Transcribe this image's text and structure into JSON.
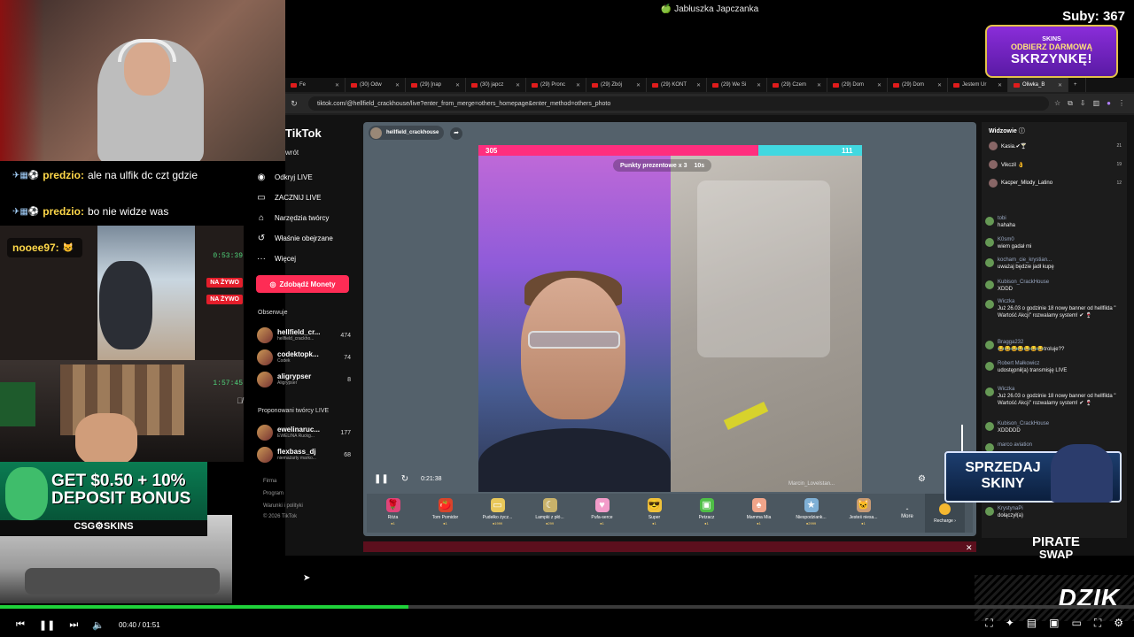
{
  "window": {
    "title": "🍏 Jabłuszka Japczanka"
  },
  "overlay": {
    "subs": "Suby: 367",
    "promo_brand": "SKINS",
    "promo_l1": "ODBIERZ DARMOWĄ",
    "promo_l2": "SKRZYNKĘ!",
    "chat": [
      {
        "name": "predzio:",
        "text": "ale na ulfik dc czt gdzie"
      },
      {
        "name": "predzio:",
        "text": "bo nie widze was"
      },
      {
        "name": "nooee97:",
        "text": ""
      }
    ],
    "cam_times": [
      "0:53:39",
      "1:57:45"
    ],
    "live_label": "NA ŻYWO",
    "bonus_ad_text": "GET $0.50 + 10% DEPOSIT BONUS",
    "bonus_ad_l1": "GET $0.50 + 10%",
    "bonus_ad_l2": "DEPOSIT BONUS",
    "bonus_ad_brand": "CSG⚙SKINS",
    "sell_ad_l1": "SPRZEDAJ",
    "sell_ad_l2": "SKINY",
    "pirate_l1": "PIRATE",
    "pirate_l2": "SWAP",
    "dzik_logo": "DZIK"
  },
  "browser": {
    "tabs": [
      {
        "label": "Fe"
      },
      {
        "label": "(30) Odw"
      },
      {
        "label": "(29) [nap"
      },
      {
        "label": "(30) japcz"
      },
      {
        "label": "(29) Pronc"
      },
      {
        "label": "(29) Zbój"
      },
      {
        "label": "(29) KONT"
      },
      {
        "label": "(29) We Si"
      },
      {
        "label": "(29) Czem"
      },
      {
        "label": "(29) Dom"
      },
      {
        "label": "(29) Dom"
      },
      {
        "label": "Jestem Ur"
      },
      {
        "label": "Oliwka_B"
      }
    ],
    "url": "tiktok.com/@hellfield_crackhouse/live?enter_from_merge=others_homepage&enter_method=others_photo"
  },
  "tiktok": {
    "logo": "TikTok",
    "back": "wrót",
    "menu": [
      {
        "icon": "◉",
        "label": "Odkryj LIVE"
      },
      {
        "icon": "▭",
        "label": "ZACZNIJ LIVE"
      },
      {
        "icon": "⌂",
        "label": "Narzędzia twórcy"
      },
      {
        "icon": "↺",
        "label": "Właśnie obejrzane"
      },
      {
        "icon": "···",
        "label": "Więcej"
      }
    ],
    "coins_button": "Zdobądź Monety",
    "following_header": "Obserwuje",
    "following": [
      {
        "name": "hellfield_cr...",
        "sub": "hellfield_crackho...",
        "count": "474"
      },
      {
        "name": "codektopk...",
        "sub": "Codek",
        "count": "74"
      },
      {
        "name": "aligrypser",
        "sub": "Aligrypser",
        "count": "8"
      }
    ],
    "suggested_header": "Proponowani twórcy LIVE",
    "suggested": [
      {
        "name": "ewelinaruc...",
        "sub": "EWELINA Ruckg...",
        "count": "177"
      },
      {
        "name": "flexbass_dj",
        "sub": "niemażarty marko...",
        "count": "68"
      }
    ],
    "footer": [
      "Firma",
      "Program",
      "Warunki i polityki",
      "© 2026 TikTok"
    ]
  },
  "live": {
    "host": "hellfield_crackhouse",
    "score_left": "305",
    "score_right": "111",
    "bonus_label": "Punkty prezentowe x 3",
    "bonus_timer": "10s",
    "elapsed": "0:21:38",
    "right_name": "Marcin_Lovelstan...",
    "battle_split": 0.73,
    "gifts": [
      {
        "icon": "🌹",
        "name": "Róża",
        "price": "●1",
        "color": "#e0457a"
      },
      {
        "icon": "🍅",
        "name": "Tom Pomidor",
        "price": "●1",
        "color": "#d9442b"
      },
      {
        "icon": "▭",
        "name": "Pudełko życz...",
        "price": "●1999",
        "color": "#e9c85a"
      },
      {
        "icon": "☾",
        "name": "Lampki z płó...",
        "price": "●299",
        "color": "#c9b26a"
      },
      {
        "icon": "♥",
        "name": "Pufa-serce",
        "price": "●1",
        "color": "#f29bc9"
      },
      {
        "icon": "😎",
        "name": "Super",
        "price": "●1",
        "color": "#f0c23a"
      },
      {
        "icon": "▣",
        "name": "Petzacz",
        "price": "●1",
        "color": "#4fbf46"
      },
      {
        "icon": "♠",
        "name": "Mamma Mia",
        "price": "●1",
        "color": "#f0a58a"
      },
      {
        "icon": "★",
        "name": "Niespodziank...",
        "price": "●2999",
        "color": "#7fb0d6"
      },
      {
        "icon": "🐱",
        "name": "Jesteś niesa...",
        "price": "●1",
        "color": "#c89a74"
      }
    ],
    "more": "More",
    "recharge": "Recharge ›"
  },
  "chat_panel": {
    "viewers_header": "Widzowie",
    "viewers": [
      {
        "name": "Kasia.✔🍸",
        "rank": "21"
      },
      {
        "name": "Vikczil 👌",
        "rank": "19"
      },
      {
        "name": "Kacper_Mlody_Latino",
        "rank": "12"
      }
    ],
    "messages": [
      {
        "user": "tobi",
        "text": "hahaha"
      },
      {
        "user": "K0sm0",
        "text": "wiem gadał mi"
      },
      {
        "user": "kocham_cie_krystian...",
        "text": "uważaj będzie jadł kupę"
      },
      {
        "user": "Kubison_CrackHouse",
        "text": "XDDD"
      },
      {
        "user": "Wiczka",
        "text": "Już 26.03 o godzinie 18 nowy banner od hellfilda \" Wartość Akcji\" rozwalamy system! ✔ 🍷"
      },
      {
        "user": "Bragga232",
        "text": "😂😂😂😂😂😂😂troluje??"
      },
      {
        "user": "Robert Małkowicz",
        "text": "udostępnił(a) transmisję LIVE"
      },
      {
        "user": "Wiczka",
        "text": "Już 26.03 o godzinie 18 nowy banner od hellfilda \" Wartość Akcji\" rozwalamy system! ✔ 🍷"
      },
      {
        "user": "Kubison_CrackHouse",
        "text": "XDDDDD"
      },
      {
        "user": "marco aviation",
        "text": ""
      },
      {
        "user": "KrystynaPi",
        "text": "dołączył(a)"
      }
    ]
  },
  "player": {
    "time": "00:40 / 01:51",
    "progress": 0.36
  }
}
